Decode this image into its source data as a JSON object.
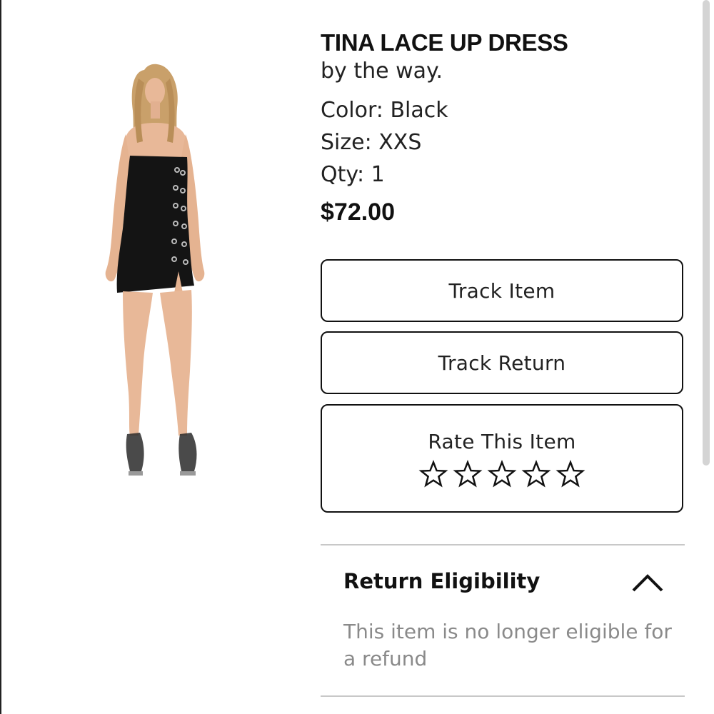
{
  "product": {
    "title": "TINA LACE UP DRESS",
    "brand": "by the way.",
    "color": "Color: Black",
    "size": "Size: XXS",
    "qty": "Qty: 1",
    "price": "$72.00"
  },
  "actions": {
    "track_item": "Track Item",
    "track_return": "Track Return",
    "rate_label": "Rate This Item",
    "rating": {
      "value": 0,
      "max": 5,
      "icon": "star-outline-icon"
    }
  },
  "return_eligibility": {
    "title": "Return Eligibility",
    "expanded": true,
    "message": "This item is no longer eligible for a refund",
    "toggle_icon": "chevron-up-icon"
  },
  "colors": {
    "dress": "#141414",
    "skin": "#e8b898",
    "hair": "#c9a06a",
    "muted_text": "#8a8a8a",
    "divider": "#c8c8c8"
  }
}
